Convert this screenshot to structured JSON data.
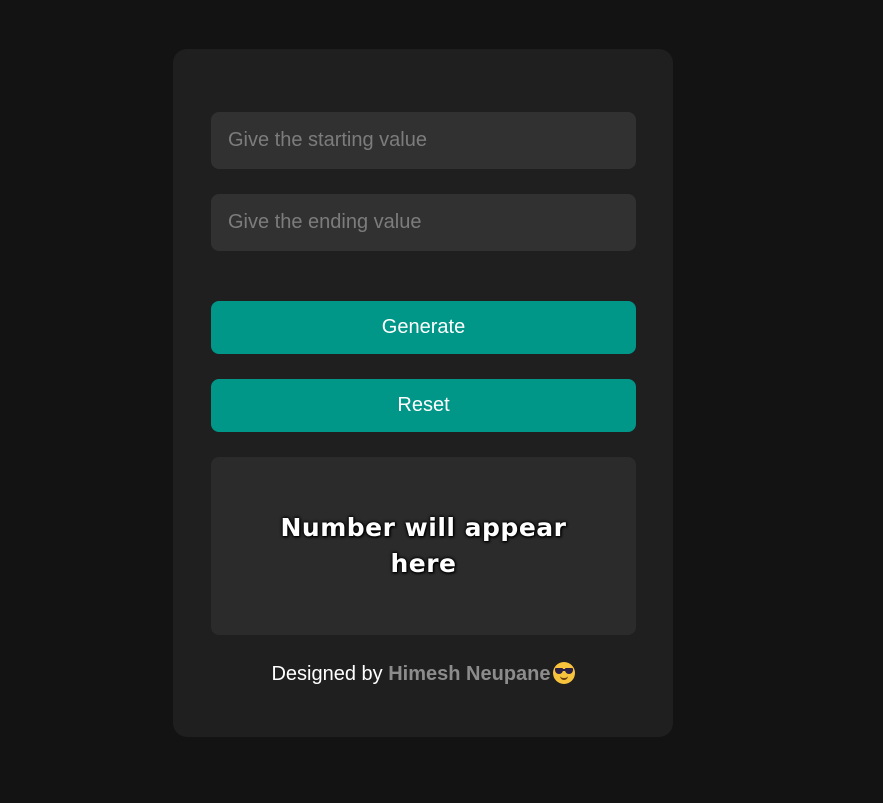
{
  "form": {
    "start_placeholder": "Give the starting value",
    "end_placeholder": "Give the ending value",
    "generate_label": "Generate",
    "reset_label": "Reset"
  },
  "result": {
    "text": "Number will appear here"
  },
  "footer": {
    "prefix": "Designed by",
    "author": "Himesh Neupane",
    "emoji_icon": "smiling-face-with-sunglasses-icon"
  },
  "colors": {
    "page_background": "#131313",
    "card_background": "#1f1f1f",
    "input_background": "#313131",
    "accent": "#009688",
    "result_background": "#2b2b2b",
    "author_text": "#8c8c8c"
  }
}
